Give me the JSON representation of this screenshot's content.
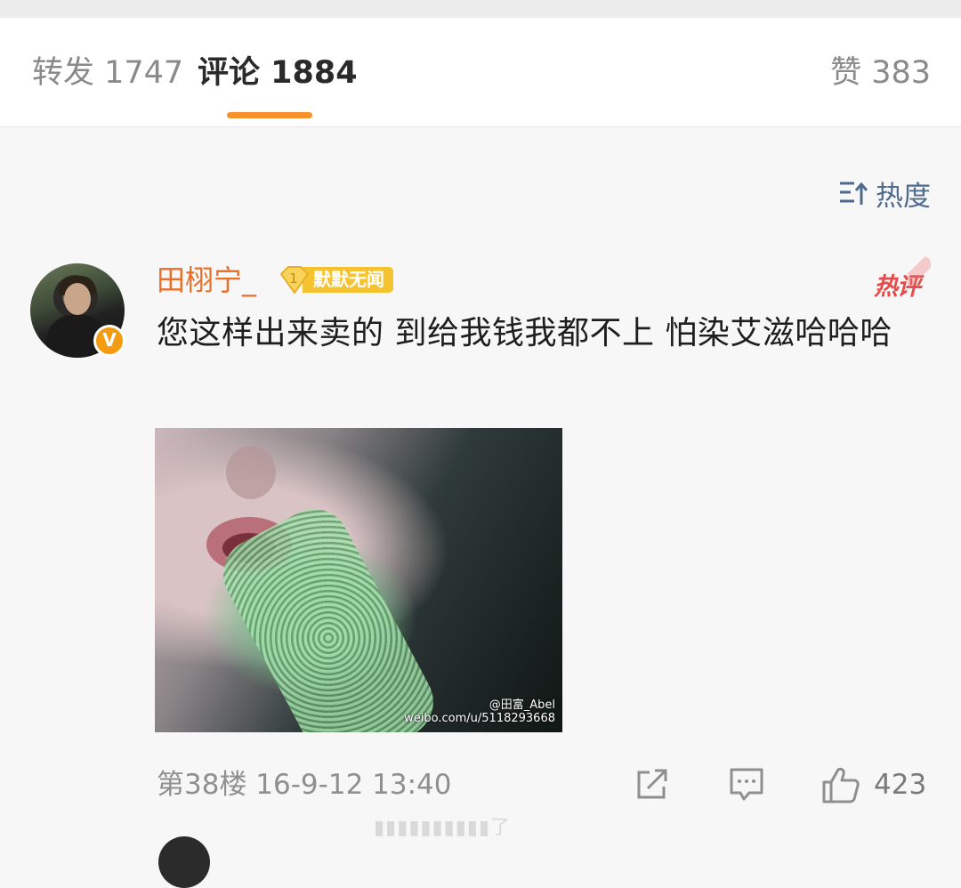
{
  "tabs": {
    "forward": "转发 1747",
    "comment": "评论 1884",
    "like": "赞 383"
  },
  "sort": {
    "label": "热度"
  },
  "comment": {
    "username": "田栩宁_",
    "badge_level": "1",
    "badge_label": "默默无闻",
    "verify_mark": "V",
    "hot_tag": "热评",
    "text": "您这样出来卖的 到给我钱我都不上 怕染艾滋哈哈哈",
    "image_watermark_line1": "@田富_Abel",
    "image_watermark_line2": "weibo.com/u/5118293668",
    "meta": "第38楼 16-9-12 13:40",
    "like_count": "423"
  },
  "peek": {
    "text": "了"
  },
  "colors": {
    "accent": "#f7912b",
    "username": "#e8702a",
    "hot": "#e54b4b",
    "sort": "#4e6a8c"
  }
}
